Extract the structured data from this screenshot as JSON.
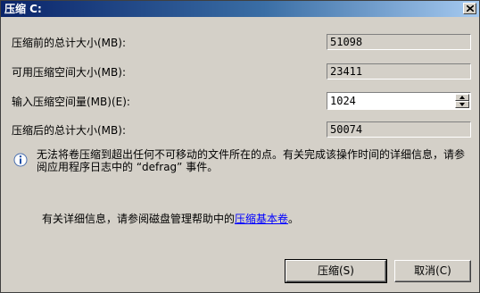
{
  "window": {
    "title": "压缩 C:"
  },
  "fields": {
    "total_before": {
      "label": "压缩前的总计大小(MB):",
      "value": "51098"
    },
    "available": {
      "label": "可用压缩空间大小(MB):",
      "value": "23411"
    },
    "input": {
      "label": "输入压缩空间量(MB)(E):",
      "value": "1024"
    },
    "total_after": {
      "label": "压缩后的总计大小(MB):",
      "value": "50074"
    }
  },
  "info": {
    "text": "无法将卷压缩到超出任何不可移动的文件所在的点。有关完成该操作时间的详细信息，请参阅应用程序日志中的 “defrag” 事件。"
  },
  "help": {
    "prefix": "有关详细信息，请参阅磁盘管理帮助中的",
    "link": "压缩基本卷",
    "suffix": "。"
  },
  "buttons": {
    "shrink": "压缩(S)",
    "cancel": "取消(C)"
  }
}
